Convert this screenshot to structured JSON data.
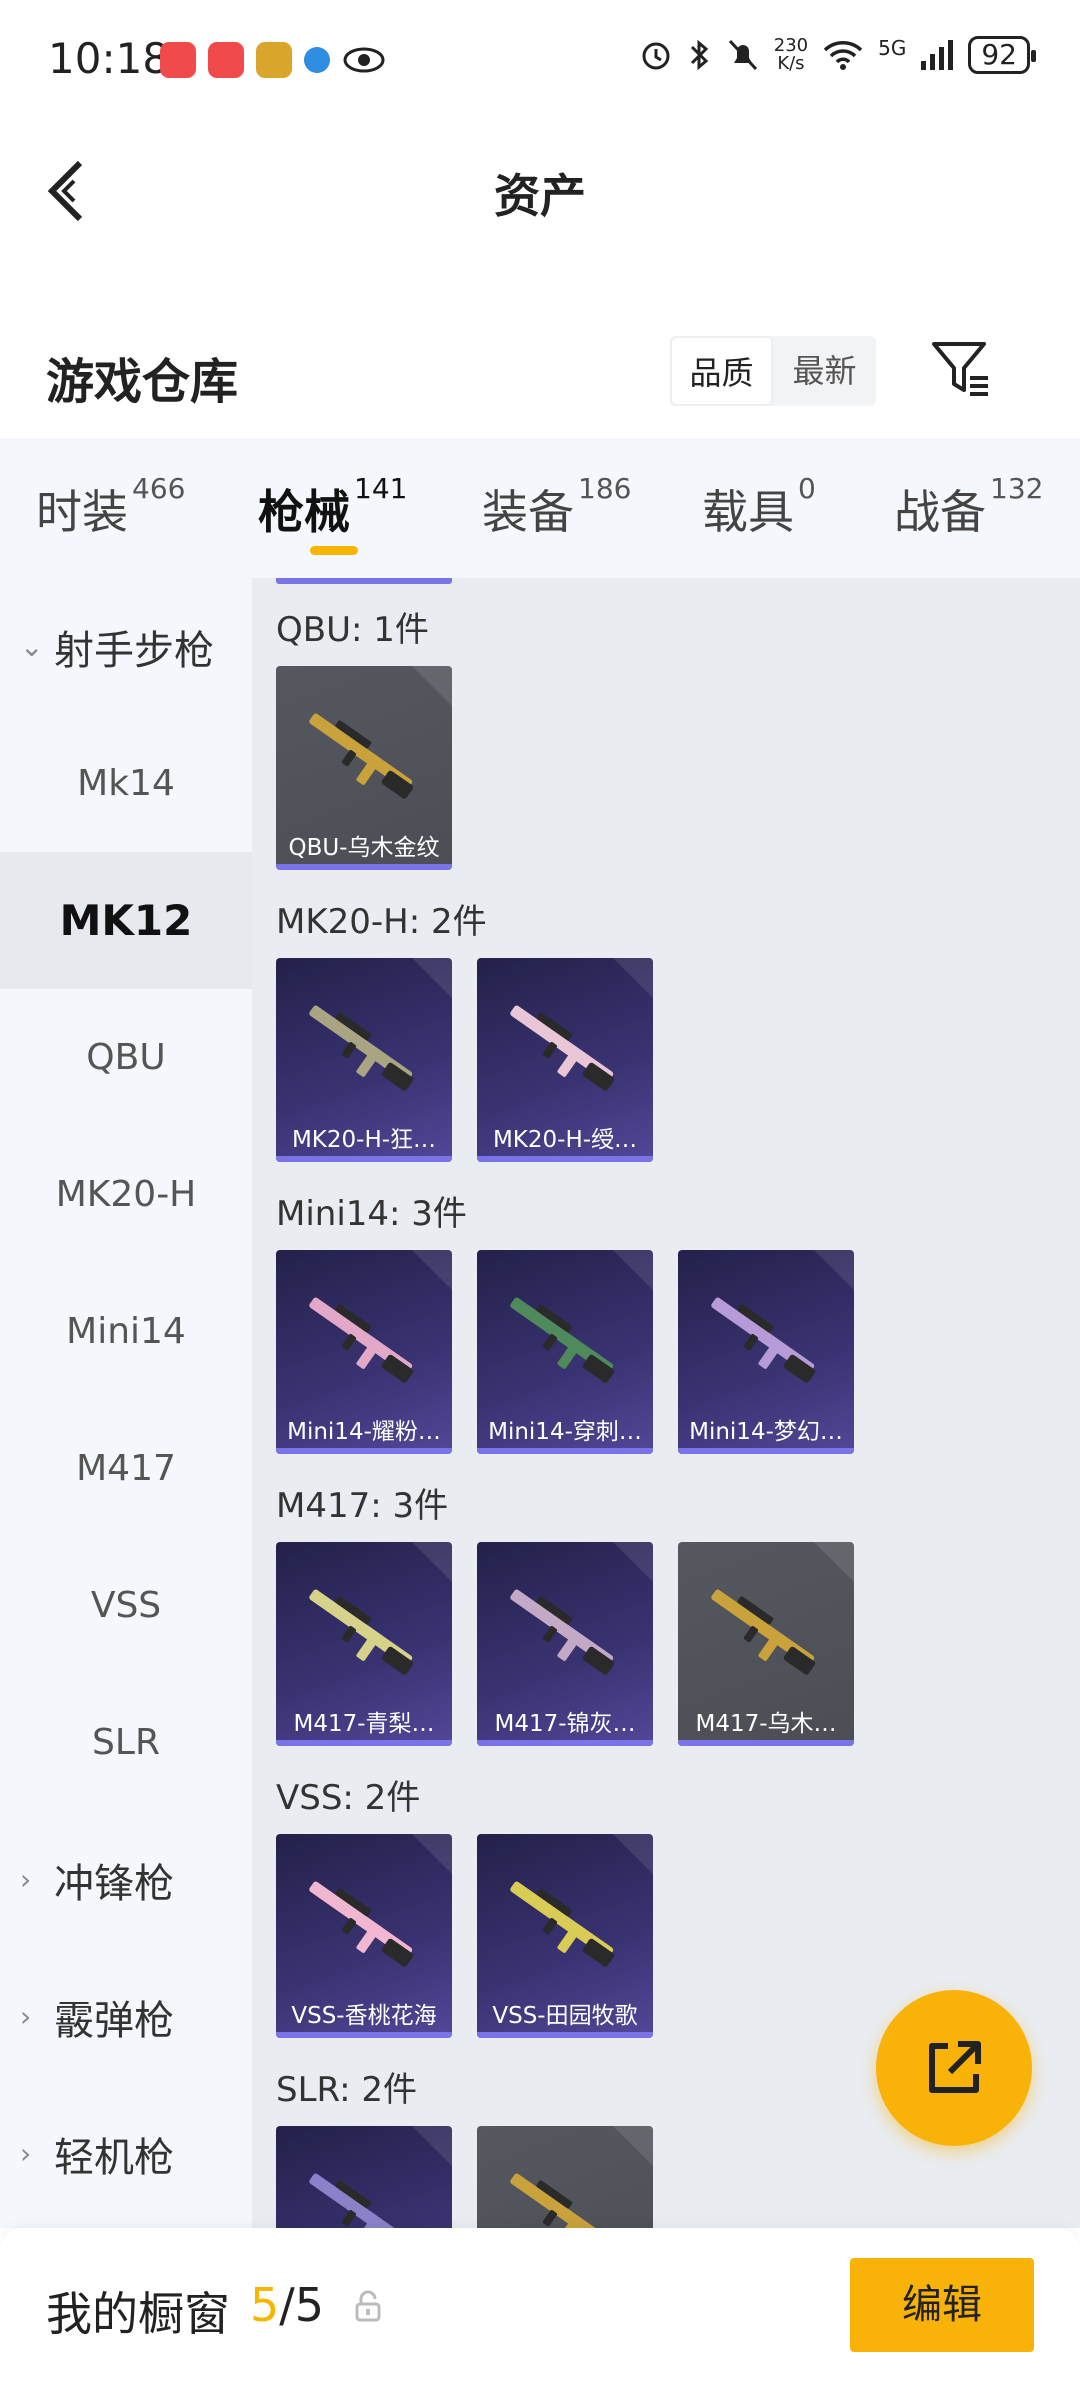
{
  "status_bar": {
    "time": "10:18",
    "net_speed_value": "230",
    "net_speed_unit": "K/s",
    "network": "5G",
    "battery": "92"
  },
  "header": {
    "title": "资产"
  },
  "warehouse": {
    "title": "游戏仓库",
    "sort_options": [
      "品质",
      "最新"
    ],
    "active_sort": "品质"
  },
  "tabs": [
    {
      "label": "时装",
      "count": "466"
    },
    {
      "label": "枪械",
      "count": "141"
    },
    {
      "label": "装备",
      "count": "186"
    },
    {
      "label": "载具",
      "count": "0"
    },
    {
      "label": "战备",
      "count": "132"
    }
  ],
  "active_tab": "枪械",
  "sidebar": {
    "items": [
      {
        "label": "射手步枪",
        "type": "group",
        "expanded": true
      },
      {
        "label": "Mk14"
      },
      {
        "label": "MK12",
        "active": true
      },
      {
        "label": "QBU"
      },
      {
        "label": "MK20-H"
      },
      {
        "label": "Mini14"
      },
      {
        "label": "M417"
      },
      {
        "label": "VSS"
      },
      {
        "label": "SLR"
      },
      {
        "label": "冲锋枪",
        "type": "group"
      },
      {
        "label": "霰弹枪",
        "type": "group"
      },
      {
        "label": "轻机枪",
        "type": "group"
      }
    ]
  },
  "sections": [
    {
      "title": "QBU: 1件",
      "items": [
        {
          "name": "QBU-乌木金纹",
          "style": "gray",
          "gun_color": "#c9a23c"
        }
      ]
    },
    {
      "title": "MK20-H: 2件",
      "items": [
        {
          "name": "MK20-H-狂…",
          "style": "purple",
          "gun_color": "#a9a583"
        },
        {
          "name": "MK20-H-绶…",
          "style": "purple",
          "gun_color": "#e9c6d6"
        }
      ]
    },
    {
      "title": "Mini14: 3件",
      "items": [
        {
          "name": "Mini14-耀粉…",
          "style": "purple",
          "gun_color": "#e2a8c8"
        },
        {
          "name": "Mini14-穿刺…",
          "style": "purple",
          "gun_color": "#4f8a5a"
        },
        {
          "name": "Mini14-梦幻…",
          "style": "purple",
          "gun_color": "#b79ad8"
        }
      ]
    },
    {
      "title": "M417: 3件",
      "items": [
        {
          "name": "M417-青梨…",
          "style": "purple",
          "gun_color": "#d7d28a"
        },
        {
          "name": "M417-锦灰…",
          "style": "purple",
          "gun_color": "#c4a9c6"
        },
        {
          "name": "M417-乌木…",
          "style": "gray",
          "gun_color": "#c9a23c"
        }
      ]
    },
    {
      "title": "VSS: 2件",
      "items": [
        {
          "name": "VSS-香桃花海",
          "style": "purple",
          "gun_color": "#f2b7d0"
        },
        {
          "name": "VSS-田园牧歌",
          "style": "purple",
          "gun_color": "#d9cc55"
        }
      ]
    },
    {
      "title": "SLR: 2件",
      "items": [
        {
          "name": "",
          "style": "purple",
          "gun_color": "#8a82c8"
        },
        {
          "name": "",
          "style": "gray",
          "gun_color": "#c9a23c"
        }
      ]
    }
  ],
  "bottom_bar": {
    "label": "我的橱窗",
    "current": "5",
    "total": "/5",
    "edit_label": "编辑"
  },
  "icons": {
    "back": "chevron-left-icon",
    "filter": "filter-icon",
    "fab": "share-external-icon",
    "lock": "lock-icon"
  },
  "colors": {
    "accent": "#f9b208",
    "card_underline": "#7b74e8",
    "content_bg": "#e9ecf0",
    "sidebar_bg": "#f4f7fb"
  }
}
